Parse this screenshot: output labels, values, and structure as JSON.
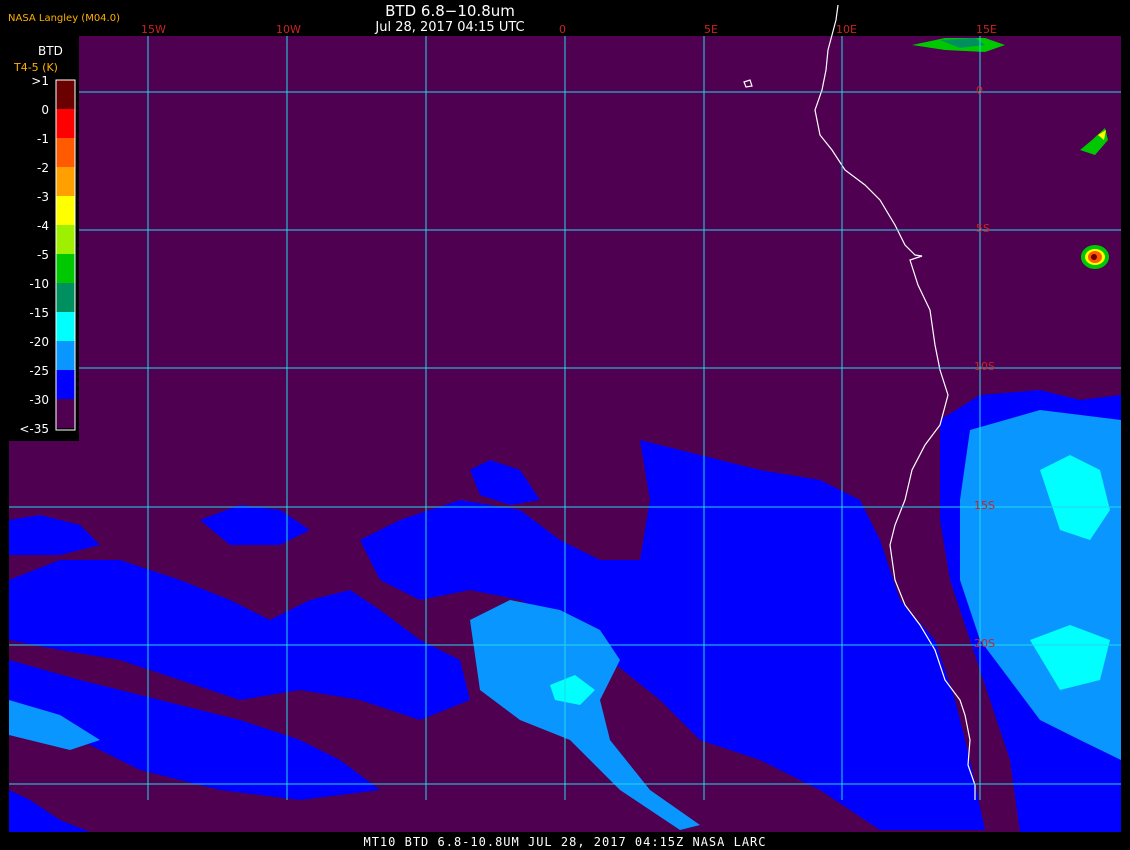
{
  "header": {
    "organization": "NASA Langley (M04.0)",
    "title": "BTD 6.8−10.8um",
    "datetime": "Jul 28, 2017 04:15 UTC"
  },
  "footer": {
    "text": "MT10  BTD 6.8-10.8UM  JUL 28, 2017 04:15Z  NASA LARC"
  },
  "legend": {
    "title": "BTD",
    "units": "T4-5 (K)",
    "bins": [
      {
        "label": ">1",
        "color": "#6b0000"
      },
      {
        "label": "0",
        "color": "#ff0000"
      },
      {
        "label": "-1",
        "color": "#ff5a00"
      },
      {
        "label": "-2",
        "color": "#ffa000"
      },
      {
        "label": "-3",
        "color": "#ffff00"
      },
      {
        "label": "-4",
        "color": "#9ef000"
      },
      {
        "label": "-5",
        "color": "#00c800"
      },
      {
        "label": "-10",
        "color": "#009060"
      },
      {
        "label": "-15",
        "color": "#00ffff"
      },
      {
        "label": "-20",
        "color": "#0a96ff"
      },
      {
        "label": "-25",
        "color": "#0000ff"
      },
      {
        "label": "-30",
        "color": "#500050"
      },
      {
        "label": "<-35",
        "color": ""
      }
    ]
  },
  "graticule": {
    "longitudes": [
      "15W",
      "10W",
      "0",
      "5E",
      "10E",
      "15E"
    ],
    "latitudes": [
      "0",
      "5S",
      "10S",
      "15S",
      "20S"
    ]
  },
  "colors": {
    "background": "#500050",
    "grid": "#22d8e8",
    "coastline": "#ffffff",
    "grid_label": "#cc2222",
    "accent_label": "#ffb000"
  }
}
